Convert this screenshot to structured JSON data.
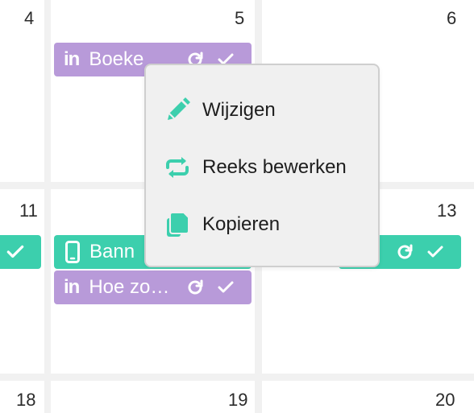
{
  "calendar": {
    "day_numbers": {
      "d4": "4",
      "d5": "5",
      "d6": "6",
      "d11": "11",
      "d12": "",
      "d13": "13",
      "d18": "18",
      "d19": "19",
      "d20": "20"
    },
    "events": {
      "e5_linkedin": {
        "platform_label": "in",
        "title": "Boeke",
        "color": "#b89ad9"
      },
      "e11_partial": {
        "color": "#3ccfad"
      },
      "e12_banner": {
        "title": "Bann",
        "color": "#3ccfad"
      },
      "e12_linkedin": {
        "platform_label": "in",
        "title": "Hoe zo…",
        "color": "#b89ad9"
      },
      "e13_partial": {
        "color": "#3ccfad"
      }
    }
  },
  "context_menu": {
    "items": [
      {
        "label": "Wijzigen",
        "icon": "pencil-icon"
      },
      {
        "label": "Reeks bewerken",
        "icon": "repeat-icon"
      },
      {
        "label": "Kopieren",
        "icon": "copy-icon"
      }
    ],
    "accent_color": "#3ccfad"
  }
}
